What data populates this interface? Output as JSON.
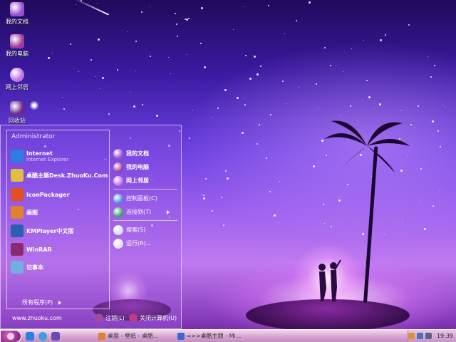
{
  "desktop": {
    "icons": [
      {
        "label": "我的文档",
        "icon": "my-documents-icon",
        "color": "#9a4fd0"
      },
      {
        "label": "我的电脑",
        "icon": "my-computer-icon",
        "color": "#a03a9a"
      },
      {
        "label": "网上邻居",
        "icon": "network-places-icon",
        "color": "#c070e0"
      },
      {
        "label": "回收站",
        "icon": "recycle-bin-icon",
        "color": "#6a2a90"
      }
    ]
  },
  "start_menu": {
    "user": "Administrator",
    "left_items": [
      {
        "label": "Internet",
        "sub": "Internet Explorer",
        "icon": "internet-explorer-icon",
        "color": "#2a7fe0"
      },
      {
        "label": "桌酷主题Desk.ZhuoKu.Com",
        "sub": "",
        "icon": "zhuoku-icon",
        "color": "#e0c040"
      },
      {
        "label": "IconPackager",
        "sub": "",
        "icon": "iconpackager-icon",
        "color": "#e05020"
      },
      {
        "label": "画图",
        "sub": "",
        "icon": "paint-icon",
        "color": "#e08030"
      },
      {
        "label": "KMPlayer中文版",
        "sub": "",
        "icon": "kmplayer-icon",
        "color": "#2a60b0"
      },
      {
        "label": "WinRAR",
        "sub": "",
        "icon": "winrar-icon",
        "color": "#8a2a70"
      },
      {
        "label": "记事本",
        "sub": "",
        "icon": "notepad-icon",
        "color": "#70b0e0"
      }
    ],
    "all_programs": "所有程序(P)",
    "website": "www.zhuoku.com",
    "right_items": [
      {
        "label": "我的文档",
        "icon": "my-documents-icon",
        "color": "#9a4fd0",
        "bold": true
      },
      {
        "label": "我的电脑",
        "icon": "my-computer-icon",
        "color": "#a03a9a",
        "bold": true
      },
      {
        "label": "网上邻居",
        "icon": "network-places-icon",
        "color": "#c070e0",
        "bold": true
      },
      {
        "label": "控制面板(C)",
        "icon": "control-panel-icon",
        "color": "#4a8ae0",
        "bold": false
      },
      {
        "label": "连接到(T)",
        "icon": "connect-to-icon",
        "color": "#3aa060",
        "bold": false
      },
      {
        "label": "搜索(S)",
        "icon": "search-icon",
        "color": "#d0e0ff",
        "bold": false
      },
      {
        "label": "运行(R)...",
        "icon": "run-icon",
        "color": "#e0e0f0",
        "bold": false
      }
    ],
    "logoff": "注销(L)",
    "shutdown": "关闭计算机(U)"
  },
  "taskbar": {
    "tasks": [
      {
        "label": "桌面 - 壁纸 - 桌酷...",
        "icon": "browser-icon",
        "color": "#e08030"
      },
      {
        "label": "=>>桌酷主题 - Mi...",
        "icon": "word-doc-icon",
        "color": "#3a6ad0"
      }
    ],
    "clock": "19:39"
  },
  "colors": {
    "accent": "#9a5fee",
    "taskbar": "#d9a8d2"
  }
}
